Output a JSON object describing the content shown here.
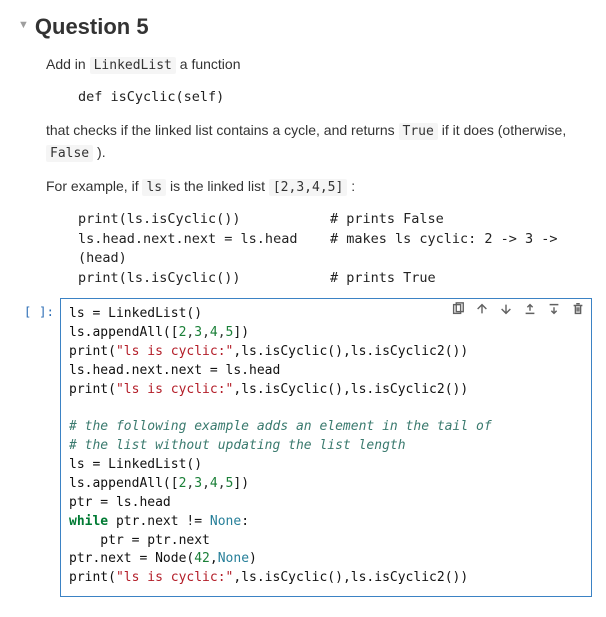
{
  "heading": "Question 5",
  "p1_a": "Add in ",
  "p1_code": "LinkedList",
  "p1_b": " a function",
  "def_block": "def isCyclic(self)",
  "p2_a": "that checks if the linked list contains a cycle, and returns ",
  "p2_true": "True",
  "p2_b": " if it does (otherwise, ",
  "p2_false": "False",
  "p2_c": " ).",
  "p3_a": "For example, if ",
  "p3_ls": "ls",
  "p3_b": " is the linked list ",
  "p3_list": "[2,3,4,5]",
  "p3_c": " :",
  "ex_l1_a": "print(ls.isCyclic())",
  "ex_l1_b": "# prints False",
  "ex_l2_a": "ls.head.next.next = ls.head",
  "ex_l2_b": "# makes ls cyclic: 2 -> 3 ->",
  "ex_l3": "(head)",
  "ex_l4_a": "print(ls.isCyclic())",
  "ex_l4_b": "# prints True",
  "prompt_label": "[ ]:",
  "code": {
    "l01a": "ls = LinkedList()",
    "l02a": "ls.appendAll([",
    "l02n1": "2",
    "l02n2": "3",
    "l02n3": "4",
    "l02n4": "5",
    "l02b": "])",
    "l03a": "print(",
    "l03s": "\"ls is cyclic:\"",
    "l03b": ",ls.isCyclic(),ls.isCyclic2())",
    "l04a": "ls.head.next.next = ls.head",
    "l05a": "print(",
    "l05s": "\"ls is cyclic:\"",
    "l05b": ",ls.isCyclic(),ls.isCyclic2())",
    "l07c": "# the following example adds an element in the tail of",
    "l08c": "# the list without updating the list length",
    "l09a": "ls = LinkedList()",
    "l10a": "ls.appendAll([",
    "l10n1": "2",
    "l10n2": "3",
    "l10n3": "4",
    "l10n4": "5",
    "l10b": "])",
    "l11a": "ptr = ls.head",
    "l12kw": "while",
    "l12a": " ptr.next != ",
    "l12sp": "None",
    "l12b": ":",
    "l13a": "    ptr = ptr.next",
    "l14a": "ptr.next = Node(",
    "l14n1": "42",
    "l14b": ",",
    "l14sp": "None",
    "l14c": ")",
    "l15a": "print(",
    "l15s": "\"ls is cyclic:\"",
    "l15b": ",ls.isCyclic(),ls.isCyclic2())"
  }
}
